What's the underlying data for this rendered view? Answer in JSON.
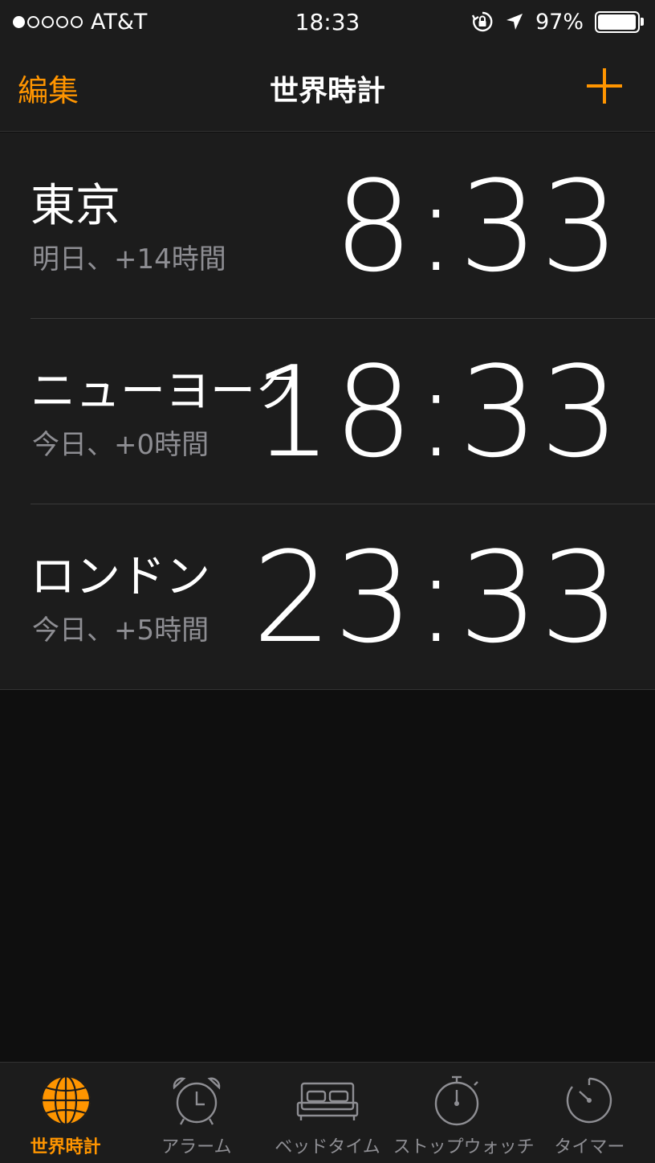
{
  "status_bar": {
    "carrier": "AT&T",
    "time": "18:33",
    "battery": "97%",
    "battery_level": 0.97,
    "signal_bars_filled": 1,
    "signal_bars_total": 5
  },
  "nav": {
    "edit_label": "編集",
    "title": "世界時計",
    "add_icon": "plus-icon"
  },
  "clocks": [
    {
      "city": "東京",
      "offset": "明日、+14時間",
      "time": "8:33"
    },
    {
      "city": "ニューヨーク",
      "offset": "今日、+0時間",
      "time": "18:33"
    },
    {
      "city": "ロンドン",
      "offset": "今日、+5時間",
      "time": "23:33"
    }
  ],
  "tabs": [
    {
      "label": "世界時計",
      "icon": "globe-icon",
      "active": true
    },
    {
      "label": "アラーム",
      "icon": "alarm-clock-icon",
      "active": false
    },
    {
      "label": "ベッドタイム",
      "icon": "bed-icon",
      "active": false
    },
    {
      "label": "ストップウォッチ",
      "icon": "stopwatch-icon",
      "active": false
    },
    {
      "label": "タイマー",
      "icon": "timer-icon",
      "active": false
    }
  ],
  "colors": {
    "accent": "#ff9500",
    "background": "#0f0f0f",
    "surface": "#1c1c1c",
    "secondary_text": "#8e8e93"
  }
}
